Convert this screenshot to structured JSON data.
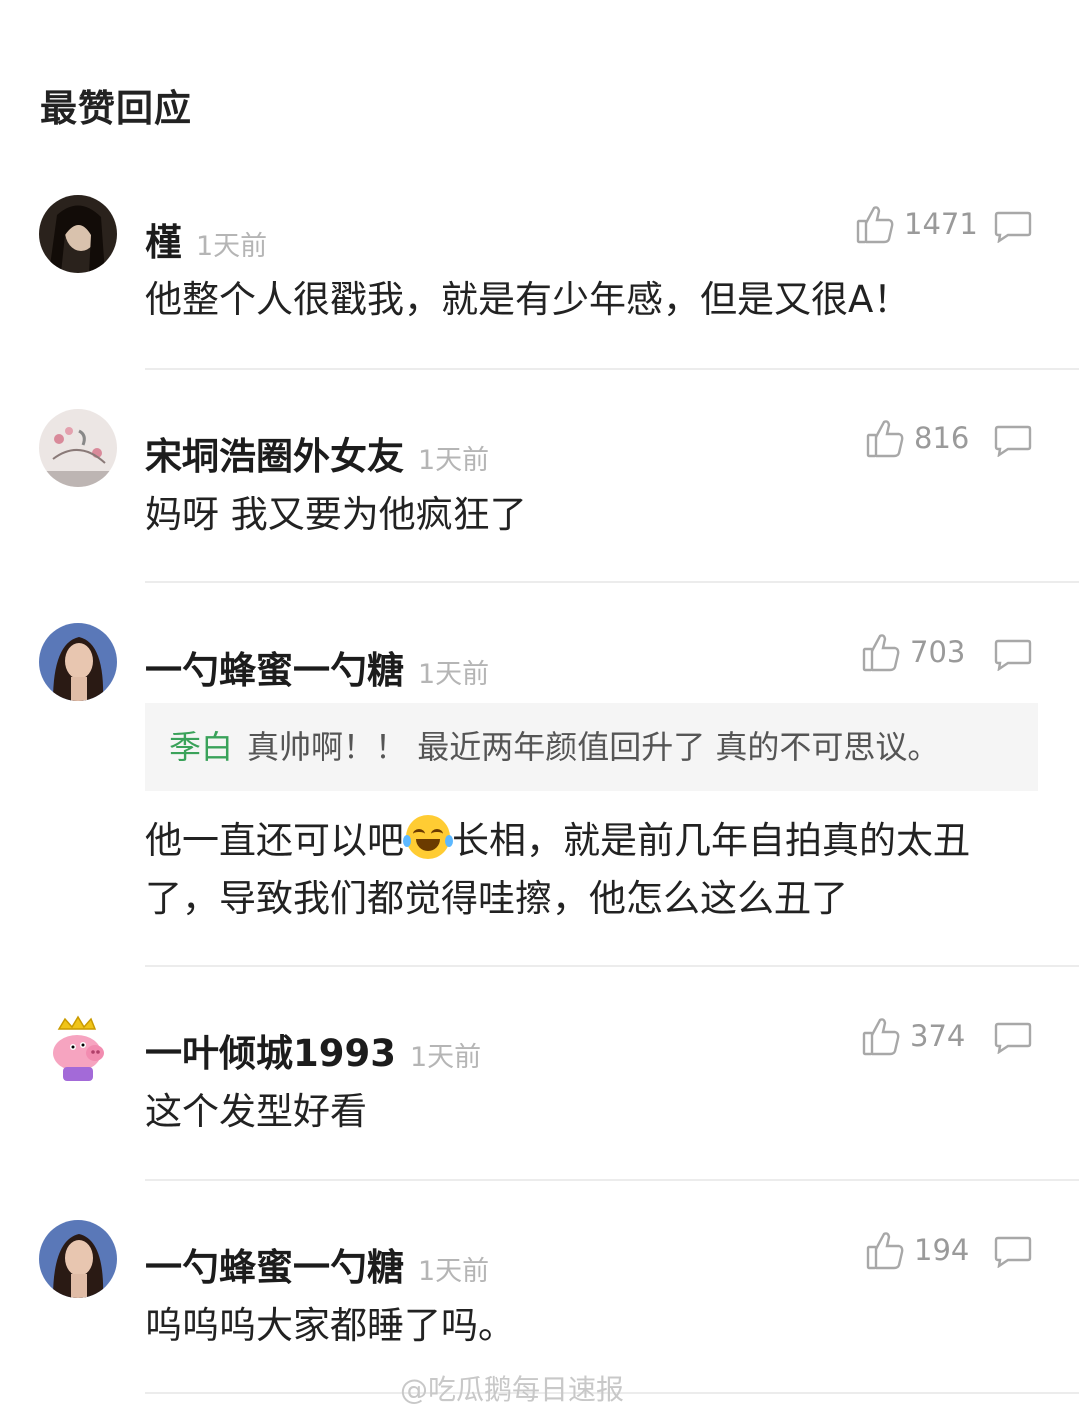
{
  "section_title": "最赞回应",
  "comments": [
    {
      "name": "槿",
      "time": "1天前",
      "likes": "1471",
      "text": "他整个人很戳我，就是有少年感，但是又很A！"
    },
    {
      "name": "宋垌浩圈外女友",
      "time": "1天前",
      "likes": "816",
      "text": "妈呀 我又要为他疯狂了"
    },
    {
      "name": "一勺蜂蜜一勺糖",
      "time": "1天前",
      "likes": "703",
      "quote_name": "季白",
      "quote_text": "真帅啊！！ 最近两年颜值回升了 真的不可思议。",
      "text_line1_a": "他一直还可以吧",
      "text_line1_b": "长相，就是前几年自拍真的太丑",
      "text_line2": "了，导致我们都觉得哇擦，他怎么这么丑了"
    },
    {
      "name": "一叶倾城1993",
      "time": "1天前",
      "likes": "374",
      "text": "这个发型好看"
    },
    {
      "name": "一勺蜂蜜一勺糖",
      "time": "1天前",
      "likes": "194",
      "text": "呜呜呜大家都睡了吗。"
    }
  ],
  "watermark": "@吃瓜鹅每日速报",
  "colors": {
    "quote_name": "#3aa25a",
    "muted": "#9a9a9a",
    "divider": "#ececec"
  }
}
